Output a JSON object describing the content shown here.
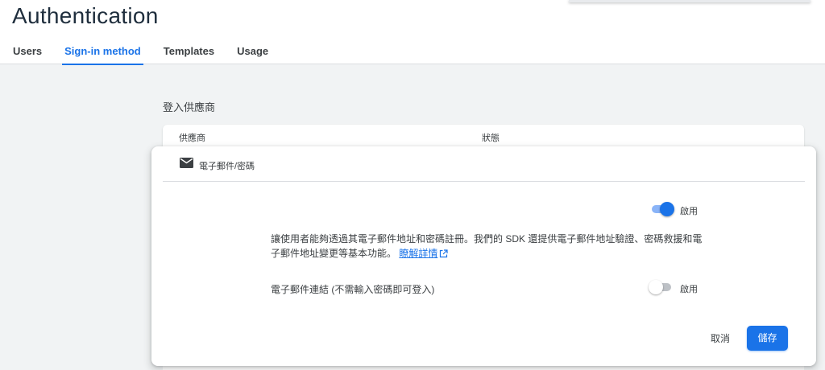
{
  "page": {
    "title": "Authentication"
  },
  "tabs": [
    {
      "label": "Users"
    },
    {
      "label": "Sign-in method"
    },
    {
      "label": "Templates"
    },
    {
      "label": "Usage"
    }
  ],
  "active_tab": "Sign-in method",
  "providers": {
    "section_title": "登入供應商",
    "columns": [
      "供應商",
      "狀態"
    ]
  },
  "editor": {
    "provider_name": "電子郵件/密碼",
    "provider_icon": "mail-icon",
    "enable_toggle": {
      "label": "啟用",
      "state": "on"
    },
    "description_text": "讓使用者能夠透過其電子郵件地址和密碼註冊。我們的 SDK 還提供電子郵件地址驗證、密碼救援和電子郵件地址變更等基本功能。",
    "learn_more_label": "瞭解詳情",
    "learn_more_icon": "external-link-icon",
    "email_link": {
      "label": "電子郵件連結 (不需輸入密碼即可登入)",
      "toggle_label": "啟用",
      "state": "off"
    },
    "cancel_label": "取消",
    "save_label": "儲存"
  },
  "colors": {
    "accent": "#1a73e8",
    "toggle_track_on": "#8ab4f8",
    "background": "#f1f3f4"
  }
}
